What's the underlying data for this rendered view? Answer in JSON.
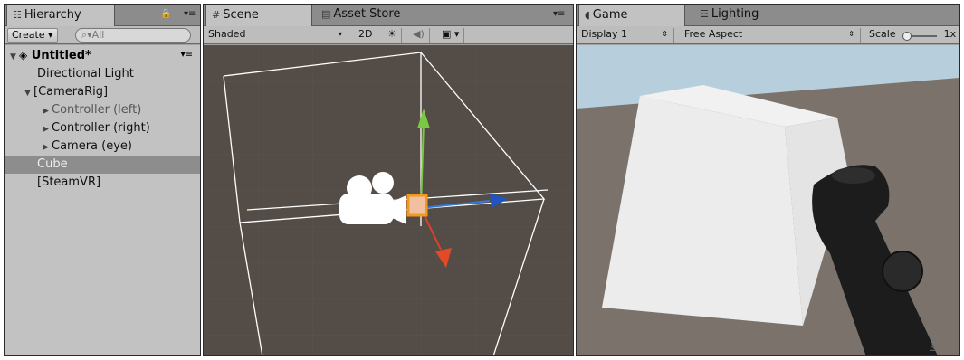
{
  "hierarchy": {
    "tab_label": "Hierarchy",
    "create_label": "Create ▾",
    "search_placeholder": "⌕▾All",
    "scene_name": "Untitled*",
    "items": [
      {
        "label": "Directional Light"
      },
      {
        "label": "[CameraRig]"
      },
      {
        "label": "Controller (left)"
      },
      {
        "label": "Controller (right)"
      },
      {
        "label": "Camera (eye)"
      },
      {
        "label": "Cube"
      },
      {
        "label": "[SteamVR]"
      }
    ]
  },
  "scene": {
    "tab_label": "Scene",
    "asset_store_tab_label": "Asset Store",
    "shading_mode": "Shaded",
    "mode_2d_label": "2D"
  },
  "game": {
    "tab_label": "Game",
    "lighting_tab_label": "Lighting",
    "display_label": "Display 1",
    "aspect_label": "Free Aspect",
    "scale_label": "Scale",
    "scale_value": "1x",
    "controller_brand": "VIVE"
  }
}
